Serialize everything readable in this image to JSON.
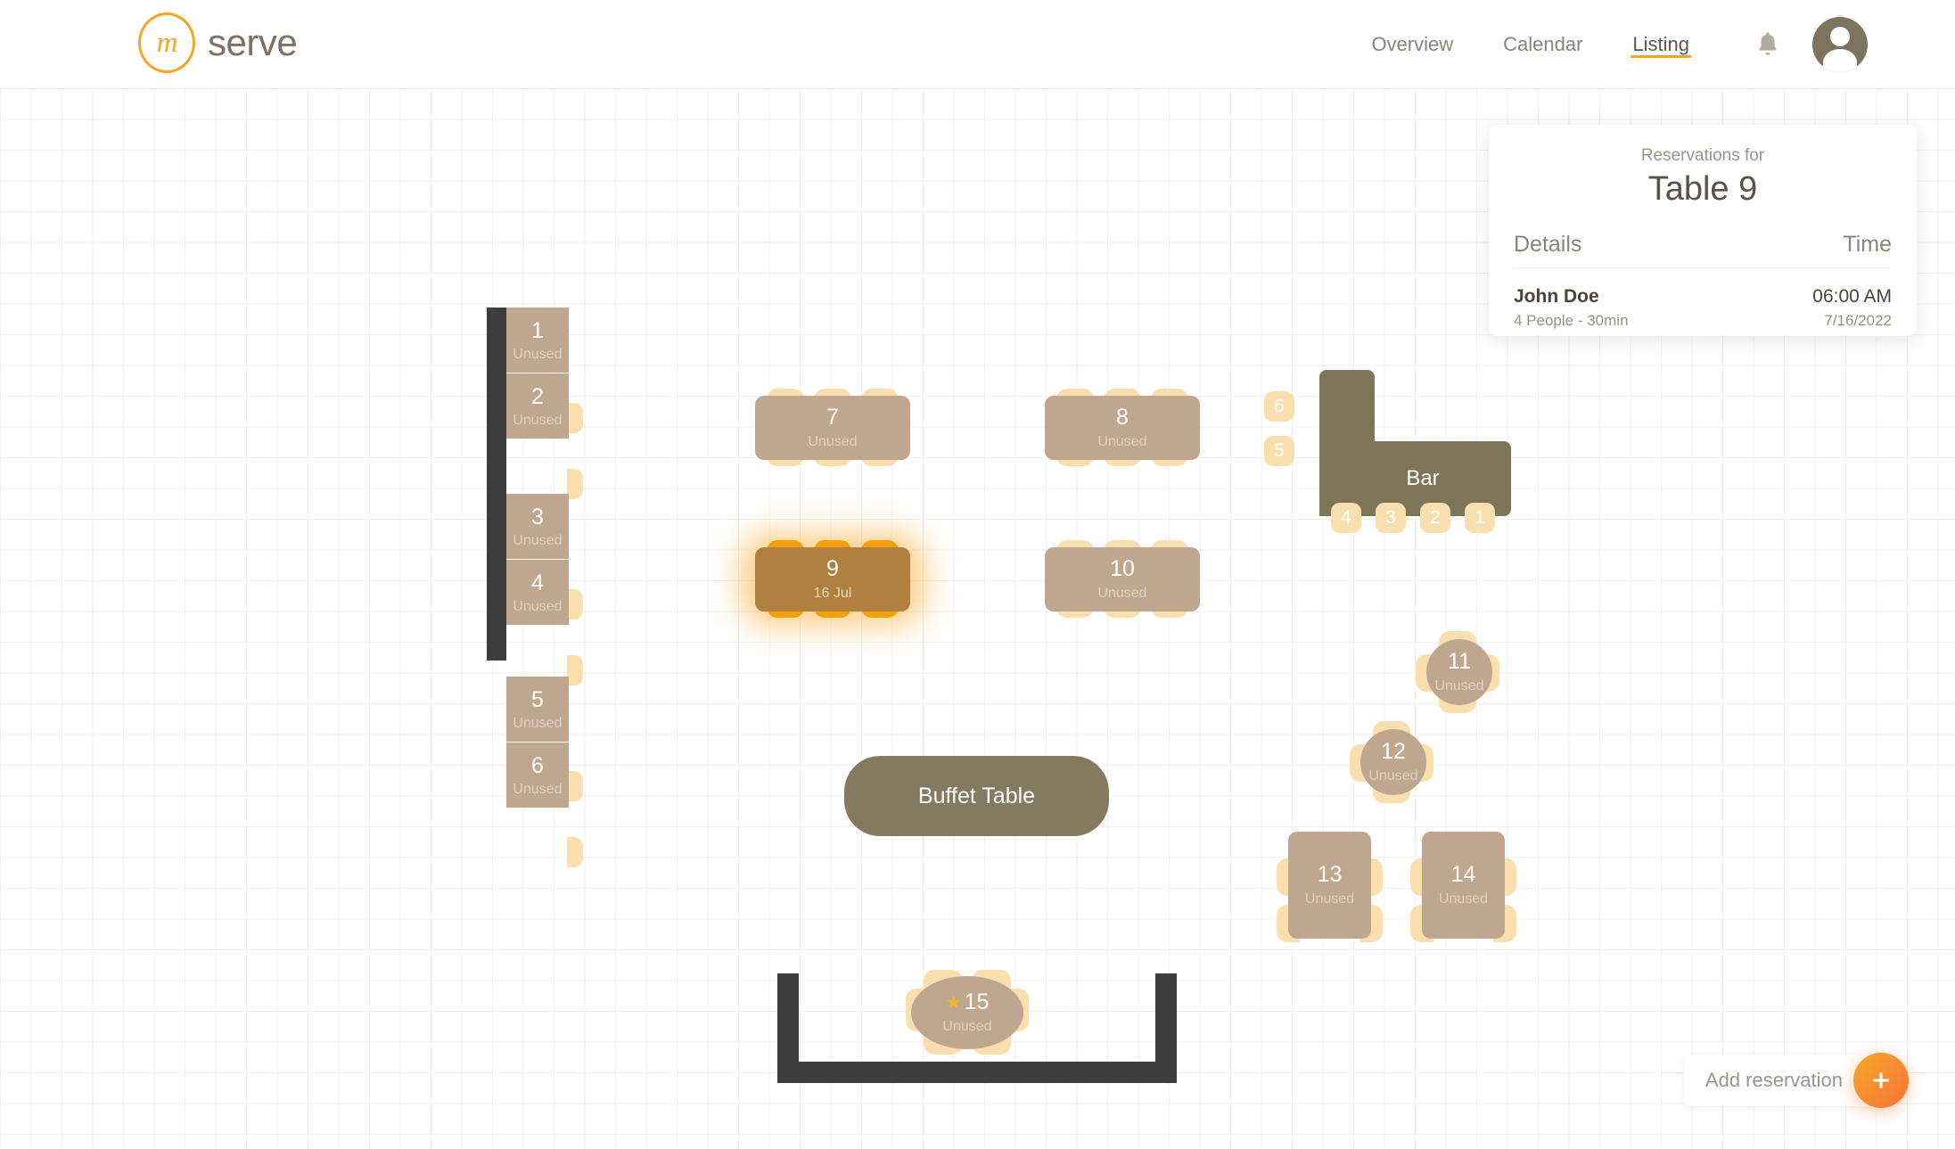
{
  "header": {
    "logo_mark": "m",
    "logo_word": "serve",
    "nav": [
      {
        "label": "Overview",
        "active": false
      },
      {
        "label": "Calendar",
        "active": false
      },
      {
        "label": "Listing",
        "active": true
      }
    ],
    "bell_icon": "bell-icon",
    "avatar_icon": "user-avatar-icon"
  },
  "panel": {
    "eyebrow": "Reservations for",
    "title": "Table 9",
    "col_details": "Details",
    "col_time": "Time",
    "reservations": [
      {
        "name": "John Doe",
        "meta": "4 People - 30min",
        "time": "06:00 AM",
        "date": "7/16/2022"
      }
    ]
  },
  "floor": {
    "booths": [
      {
        "num": "1",
        "status": "Unused"
      },
      {
        "num": "2",
        "status": "Unused"
      },
      {
        "num": "3",
        "status": "Unused"
      },
      {
        "num": "4",
        "status": "Unused"
      },
      {
        "num": "5",
        "status": "Unused"
      },
      {
        "num": "6",
        "status": "Unused"
      }
    ],
    "tables": [
      {
        "num": "7",
        "status": "Unused",
        "selected": false
      },
      {
        "num": "8",
        "status": "Unused",
        "selected": false
      },
      {
        "num": "9",
        "status": "16 Jul",
        "selected": true
      },
      {
        "num": "10",
        "status": "Unused",
        "selected": false
      },
      {
        "num": "11",
        "status": "Unused",
        "selected": false
      },
      {
        "num": "12",
        "status": "Unused",
        "selected": false
      },
      {
        "num": "13",
        "status": "Unused",
        "selected": false
      },
      {
        "num": "14",
        "status": "Unused",
        "selected": false
      },
      {
        "num": "15",
        "status": "Unused",
        "selected": false,
        "starred": true
      }
    ],
    "bar": {
      "label": "Bar",
      "stools": [
        "6",
        "5",
        "4",
        "3",
        "2",
        "1"
      ]
    },
    "buffet": {
      "label": "Buffet Table"
    }
  },
  "fab": {
    "label": "Add reservation",
    "icon": "plus-icon"
  },
  "colors": {
    "accent": "#f5a623",
    "table": "#bfa78f",
    "table_selected": "#b0803f",
    "chair": "#fadfae",
    "chair_selected": "#f59f07",
    "wall": "#3d3d3d",
    "bar": "#7e7458",
    "buffet": "#837a5f",
    "fab_gradient_start": "#f7a827",
    "fab_gradient_end": "#f4743b"
  }
}
